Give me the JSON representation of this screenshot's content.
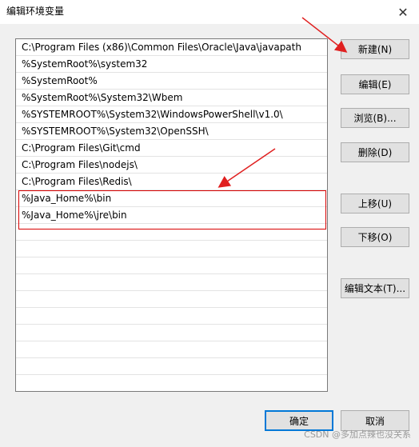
{
  "window": {
    "title": "编辑环境变量",
    "close_glyph": "✕"
  },
  "paths": [
    "C:\\Program Files (x86)\\Common Files\\Oracle\\Java\\javapath",
    "%SystemRoot%\\system32",
    "%SystemRoot%",
    "%SystemRoot%\\System32\\Wbem",
    "%SYSTEMROOT%\\System32\\WindowsPowerShell\\v1.0\\",
    "%SYSTEMROOT%\\System32\\OpenSSH\\",
    "C:\\Program Files\\Git\\cmd",
    "C:\\Program Files\\nodejs\\",
    "C:\\Program Files\\Redis\\",
    "%Java_Home%\\bin",
    "%Java_Home%\\jre\\bin"
  ],
  "buttons": {
    "new": "新建(N)",
    "edit": "编辑(E)",
    "browse": "浏览(B)...",
    "delete": "删除(D)",
    "move_up": "上移(U)",
    "move_down": "下移(O)",
    "edit_text": "编辑文本(T)...",
    "ok": "确定",
    "cancel": "取消"
  },
  "annotations": {
    "color": "#e02020"
  },
  "watermark": "CSDN @多加点辣也没关系"
}
